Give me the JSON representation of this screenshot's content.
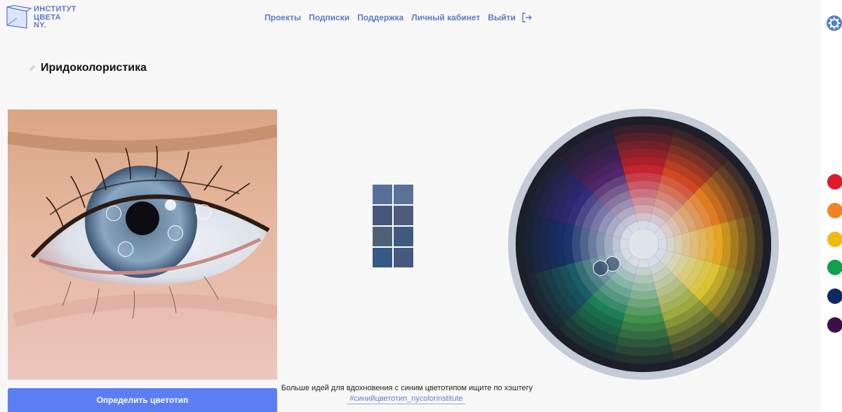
{
  "header": {
    "logo_lines": [
      "ИНСТИТУТ",
      "ЦВЕТА",
      "NY."
    ],
    "nav": [
      {
        "label": "Проекты"
      },
      {
        "label": "Подписки"
      },
      {
        "label": "Поддержка"
      },
      {
        "label": "Личный кабинет"
      },
      {
        "label": "Выйти"
      }
    ]
  },
  "page": {
    "title": "Иридоколористика"
  },
  "eye_pickers": [
    {
      "id": "picker-1"
    },
    {
      "id": "picker-2"
    },
    {
      "id": "picker-3"
    },
    {
      "id": "picker-4"
    }
  ],
  "palette_grid": {
    "colors": [
      "#56709a",
      "#5a7198",
      "#45577b",
      "#4d5c7a",
      "#4f6275",
      "#3f5a7f",
      "#355a86",
      "#47597f"
    ]
  },
  "color_wheel": {
    "sectors": [
      "#c5202a",
      "#d1441f",
      "#e07a1c",
      "#e4a51e",
      "#d9c22a",
      "#9aa83a",
      "#3e8f4a",
      "#1a7c54",
      "#165a63",
      "#16306a",
      "#2f2a7a",
      "#4e2268"
    ],
    "ring_color": "#c3cbd6",
    "center_color": "#dfe3ea"
  },
  "side_swatches": [
    {
      "name": "red",
      "color": "#e0192b"
    },
    {
      "name": "orange",
      "color": "#f18421"
    },
    {
      "name": "yellow",
      "color": "#f4b911"
    },
    {
      "name": "green",
      "color": "#0fa14b"
    },
    {
      "name": "dark-blue",
      "color": "#0f2a63",
      "active": true
    },
    {
      "name": "purple",
      "color": "#3d0f4a"
    }
  ],
  "footer": {
    "button_label": "Определить цветотип",
    "hint_text": "Больше идей для вдохновения с синим цветотипом ищите по хэштегу",
    "hashtag": "#синийцветотип_nycolorinstitute"
  }
}
